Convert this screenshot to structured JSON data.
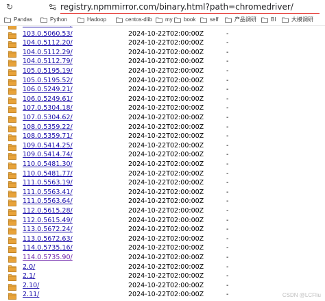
{
  "address_bar": {
    "url": "registry.npmmirror.com/binary.html?path=chromedriver/"
  },
  "bookmarks": [
    {
      "label": "Pandas",
      "icon": "folder-icon"
    },
    {
      "label": "Python",
      "icon": "folder-icon"
    },
    {
      "label": "Hadoop",
      "icon": "folder-icon"
    },
    {
      "label": "centos-dlib",
      "icon": "folder-icon"
    },
    {
      "label": "my",
      "icon": "folder-icon"
    },
    {
      "label": "book",
      "icon": "folder-icon"
    },
    {
      "label": "self",
      "icon": "folder-icon"
    },
    {
      "label": "产品调研",
      "icon": "folder-icon"
    },
    {
      "label": "BI",
      "icon": "folder-icon"
    },
    {
      "label": "大模调研",
      "icon": "folder-icon"
    }
  ],
  "listing": [
    {
      "name": "103.0.5060.24/",
      "date": "2024-10-22T02:00:00Z",
      "size": "-",
      "visited": false
    },
    {
      "name": "103.0.5060.53/",
      "date": "2024-10-22T02:00:00Z",
      "size": "-",
      "visited": false
    },
    {
      "name": "104.0.5112.20/",
      "date": "2024-10-22T02:00:00Z",
      "size": "-",
      "visited": false
    },
    {
      "name": "104.0.5112.29/",
      "date": "2024-10-22T02:00:00Z",
      "size": "-",
      "visited": false
    },
    {
      "name": "104.0.5112.79/",
      "date": "2024-10-22T02:00:00Z",
      "size": "-",
      "visited": false
    },
    {
      "name": "105.0.5195.19/",
      "date": "2024-10-22T02:00:00Z",
      "size": "-",
      "visited": false
    },
    {
      "name": "105.0.5195.52/",
      "date": "2024-10-22T02:00:00Z",
      "size": "-",
      "visited": false
    },
    {
      "name": "106.0.5249.21/",
      "date": "2024-10-22T02:00:00Z",
      "size": "-",
      "visited": false
    },
    {
      "name": "106.0.5249.61/",
      "date": "2024-10-22T02:00:00Z",
      "size": "-",
      "visited": false
    },
    {
      "name": "107.0.5304.18/",
      "date": "2024-10-22T02:00:00Z",
      "size": "-",
      "visited": false
    },
    {
      "name": "107.0.5304.62/",
      "date": "2024-10-22T02:00:00Z",
      "size": "-",
      "visited": false
    },
    {
      "name": "108.0.5359.22/",
      "date": "2024-10-22T02:00:00Z",
      "size": "-",
      "visited": false
    },
    {
      "name": "108.0.5359.71/",
      "date": "2024-10-22T02:00:00Z",
      "size": "-",
      "visited": false
    },
    {
      "name": "109.0.5414.25/",
      "date": "2024-10-22T02:00:00Z",
      "size": "-",
      "visited": false
    },
    {
      "name": "109.0.5414.74/",
      "date": "2024-10-22T02:00:00Z",
      "size": "-",
      "visited": false
    },
    {
      "name": "110.0.5481.30/",
      "date": "2024-10-22T02:00:00Z",
      "size": "-",
      "visited": false
    },
    {
      "name": "110.0.5481.77/",
      "date": "2024-10-22T02:00:00Z",
      "size": "-",
      "visited": false
    },
    {
      "name": "111.0.5563.19/",
      "date": "2024-10-22T02:00:00Z",
      "size": "-",
      "visited": false
    },
    {
      "name": "111.0.5563.41/",
      "date": "2024-10-22T02:00:00Z",
      "size": "-",
      "visited": false
    },
    {
      "name": "111.0.5563.64/",
      "date": "2024-10-22T02:00:00Z",
      "size": "-",
      "visited": false
    },
    {
      "name": "112.0.5615.28/",
      "date": "2024-10-22T02:00:00Z",
      "size": "-",
      "visited": false
    },
    {
      "name": "112.0.5615.49/",
      "date": "2024-10-22T02:00:00Z",
      "size": "-",
      "visited": false
    },
    {
      "name": "113.0.5672.24/",
      "date": "2024-10-22T02:00:00Z",
      "size": "-",
      "visited": false
    },
    {
      "name": "113.0.5672.63/",
      "date": "2024-10-22T02:00:00Z",
      "size": "-",
      "visited": false
    },
    {
      "name": "114.0.5735.16/",
      "date": "2024-10-22T02:00:00Z",
      "size": "-",
      "visited": false
    },
    {
      "name": "114.0.5735.90/",
      "date": "2024-10-22T02:00:00Z",
      "size": "-",
      "visited": true
    },
    {
      "name": "2.0/",
      "date": "2024-10-22T02:00:00Z",
      "size": "-",
      "visited": false
    },
    {
      "name": "2.1/",
      "date": "2024-10-22T02:00:00Z",
      "size": "-",
      "visited": false
    },
    {
      "name": "2.10/",
      "date": "2024-10-22T02:00:00Z",
      "size": "-",
      "visited": false
    },
    {
      "name": "2.11/",
      "date": "2024-10-22T02:00:00Z",
      "size": "-",
      "visited": false
    }
  ],
  "watermark": "CSDN @LCFliu",
  "colors": {
    "link": "#1a0dab",
    "visited_link": "#681da8",
    "folder": "#e8a33a",
    "url_underline": "#e53935"
  }
}
